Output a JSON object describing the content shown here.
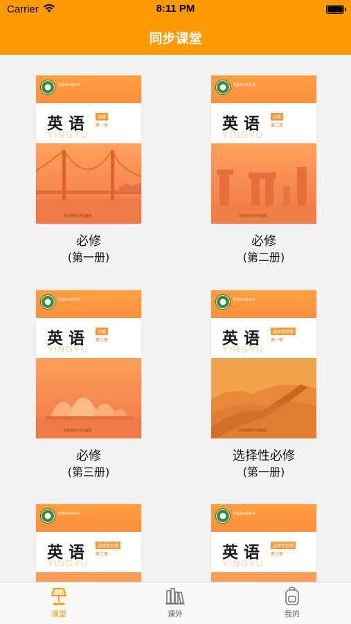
{
  "status": {
    "carrier": "Carrier",
    "time": "8:11 PM"
  },
  "nav": {
    "title": "同步课堂"
  },
  "cover_common": {
    "title": "英语",
    "pinyin": "YINGYU",
    "series": "普通高中教科书",
    "publisher": "北京师范大学出版社"
  },
  "books": [
    {
      "name": "必修",
      "volume": "(第一册)",
      "badge": "必修",
      "sub": "第一册",
      "picture": "golden-gate-bridge"
    },
    {
      "name": "必修",
      "volume": "(第二册)",
      "badge": "必修",
      "sub": "第二册",
      "picture": "stonehenge"
    },
    {
      "name": "必修",
      "volume": "(第三册)",
      "badge": "必修",
      "sub": "第三册",
      "picture": "sydney-opera-house"
    },
    {
      "name": "选择性必修",
      "volume": "(第一册)",
      "badge": "选择性必修",
      "sub": "第一册",
      "picture": "great-wall"
    },
    {
      "name": "",
      "volume": "",
      "badge": "选择性必修",
      "sub": "第二册",
      "picture": ""
    },
    {
      "name": "",
      "volume": "",
      "badge": "选择性必修",
      "sub": "第三册",
      "picture": ""
    }
  ],
  "tabs": [
    {
      "label": "课堂",
      "icon": "lamp-icon",
      "active": true
    },
    {
      "label": "课外",
      "icon": "bookshelf-icon",
      "active": false
    },
    {
      "label": "我的",
      "icon": "backpack-icon",
      "active": false
    }
  ],
  "colors": {
    "accent": "#fe9a03",
    "inactive": "#666666"
  }
}
